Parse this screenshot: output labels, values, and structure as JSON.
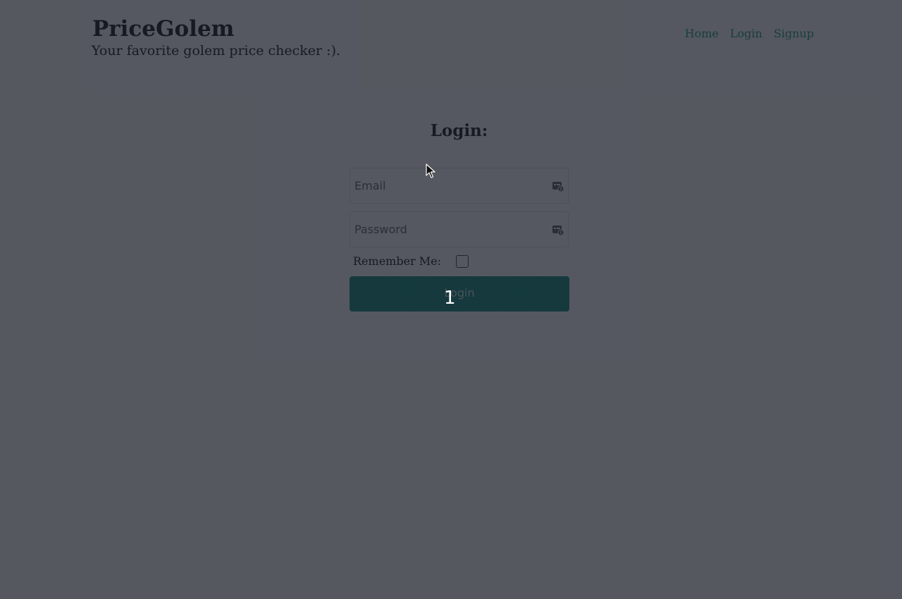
{
  "header": {
    "title": "PriceGolem",
    "tagline": "Your favorite golem price checker :).",
    "nav": [
      {
        "label": "Home"
      },
      {
        "label": "Login"
      },
      {
        "label": "Signup"
      }
    ]
  },
  "login": {
    "heading": "Login:",
    "email": {
      "placeholder": "Email",
      "value": "",
      "icon": "password-manager-icon"
    },
    "password": {
      "placeholder": "Password",
      "value": "",
      "icon": "password-manager-icon"
    },
    "remember_label": "Remember Me:",
    "remember_checked": false,
    "submit_label": "Login"
  },
  "overlay": {
    "step_number": "1",
    "dim_color": "#141822"
  },
  "colors": {
    "accent": "#1e9c8c",
    "link": "#2a9d8f",
    "text": "#222222"
  }
}
